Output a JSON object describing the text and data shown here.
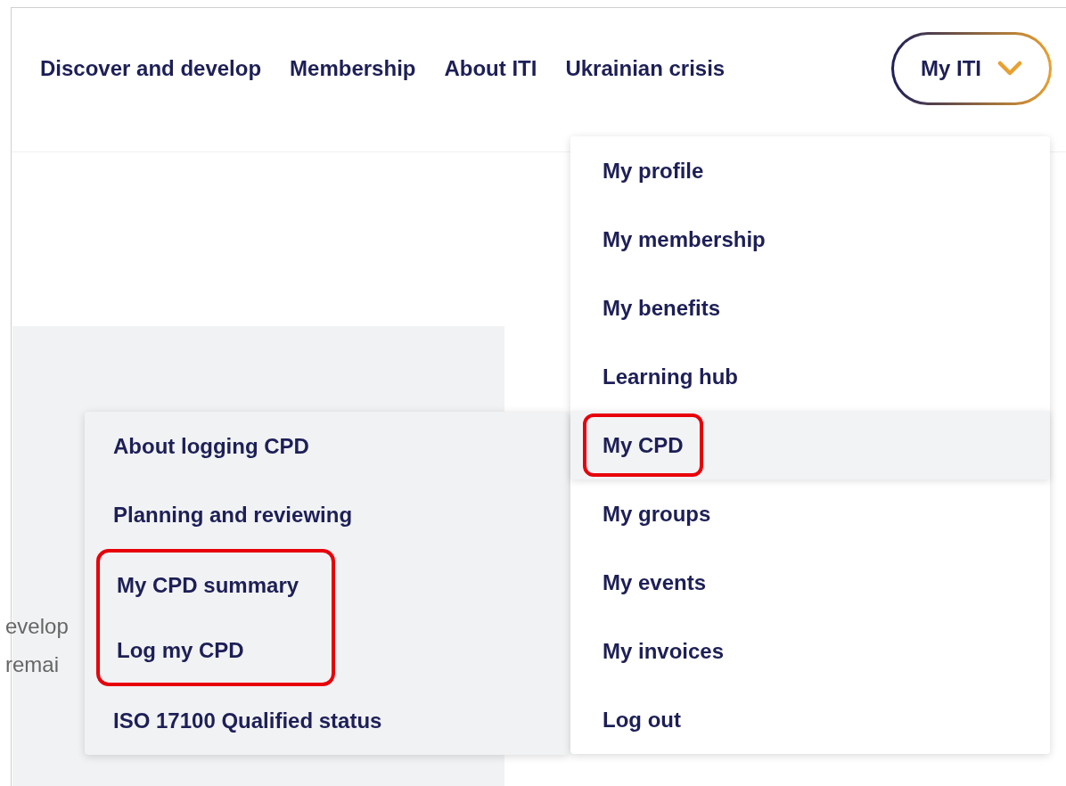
{
  "nav": {
    "links": [
      {
        "label": "Discover and develop"
      },
      {
        "label": "Membership"
      },
      {
        "label": "About ITI"
      },
      {
        "label": "Ukrainian crisis"
      }
    ],
    "account_button": {
      "label": "My ITI",
      "expanded": true
    }
  },
  "page_text": [
    "evelop",
    "remai"
  ],
  "account_menu": [
    {
      "label": "My profile",
      "selected": false,
      "highlighted": false
    },
    {
      "label": "My membership",
      "selected": false,
      "highlighted": false
    },
    {
      "label": "My benefits",
      "selected": false,
      "highlighted": false
    },
    {
      "label": "Learning hub",
      "selected": false,
      "highlighted": false
    },
    {
      "label": "My CPD",
      "selected": true,
      "highlighted": true
    },
    {
      "label": "My groups",
      "selected": false,
      "highlighted": false
    },
    {
      "label": "My events",
      "selected": false,
      "highlighted": false
    },
    {
      "label": "My invoices",
      "selected": false,
      "highlighted": false
    },
    {
      "label": "Log out",
      "selected": false,
      "highlighted": false
    }
  ],
  "cpd_submenu": [
    {
      "label": "About logging CPD",
      "highlighted": false
    },
    {
      "label": "Planning and reviewing",
      "highlighted": false
    },
    {
      "label": "My CPD summary",
      "highlighted": true
    },
    {
      "label": "Log my CPD",
      "highlighted": true
    },
    {
      "label": "ISO 17100 Qualified status",
      "highlighted": false
    }
  ]
}
